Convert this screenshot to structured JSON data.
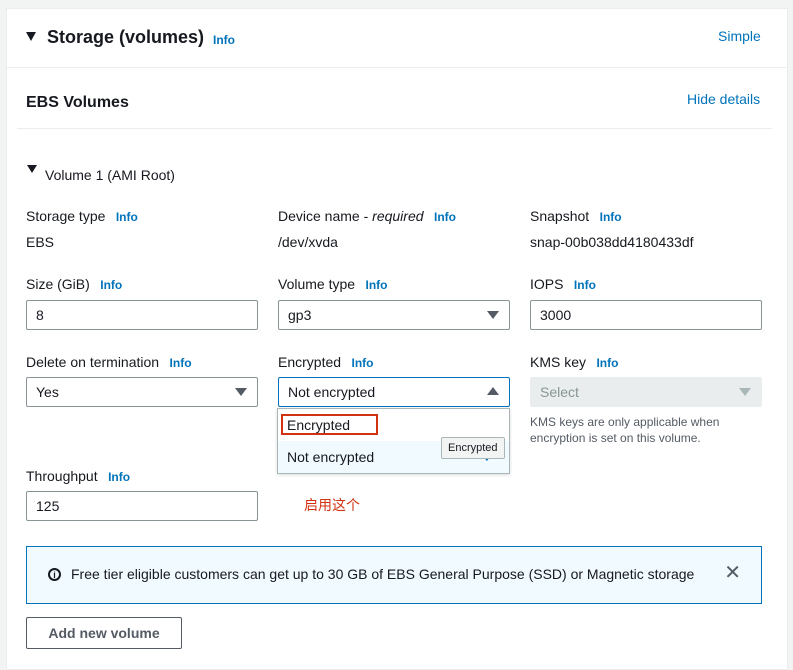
{
  "section": {
    "title": "Storage (volumes)",
    "info": "Info",
    "mode_link": "Simple"
  },
  "ebs": {
    "title": "EBS Volumes",
    "hide_details": "Hide details"
  },
  "volume": {
    "title": "Volume 1 (AMI Root)",
    "storage_type": {
      "label": "Storage type",
      "info": "Info",
      "value": "EBS"
    },
    "device_name": {
      "label": "Device name - ",
      "required": "required",
      "info": "Info",
      "value": "/dev/xvda"
    },
    "snapshot": {
      "label": "Snapshot",
      "info": "Info",
      "value": "snap-00b038dd4180433df"
    },
    "size": {
      "label": "Size (GiB)",
      "info": "Info",
      "value": "8"
    },
    "volume_type": {
      "label": "Volume type",
      "info": "Info",
      "value": "gp3"
    },
    "iops": {
      "label": "IOPS",
      "info": "Info",
      "value": "3000"
    },
    "delete_on_termination": {
      "label": "Delete on termination",
      "info": "Info",
      "value": "Yes"
    },
    "encrypted": {
      "label": "Encrypted",
      "info": "Info",
      "value": "Not encrypted",
      "options": [
        "Encrypted",
        "Not encrypted"
      ],
      "tooltip": "Encrypted"
    },
    "kms_key": {
      "label": "KMS key",
      "info": "Info",
      "placeholder": "Select",
      "help": [
        "KMS keys are only applicable when",
        "encryption is set on this volume."
      ]
    },
    "throughput": {
      "label": "Throughput",
      "info": "Info",
      "value": "125"
    },
    "annotation": "启用这个"
  },
  "alert": {
    "text": "Free tier eligible customers can get up to 30 GB of EBS General Purpose (SSD) or Magnetic storage"
  },
  "add_button": "Add new volume",
  "colors": {
    "link": "#0073bb",
    "annotation": "#d13212",
    "alert_border": "#0073bb"
  }
}
